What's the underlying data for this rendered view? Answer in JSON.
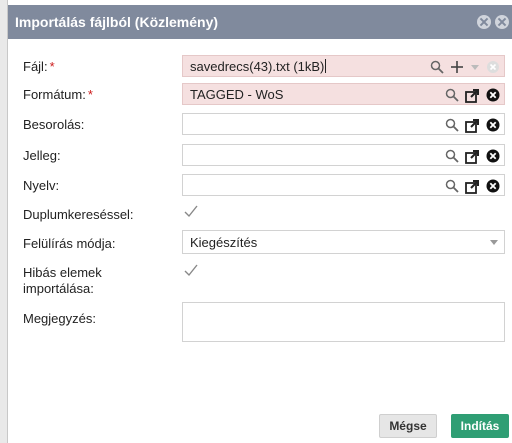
{
  "dialog": {
    "title": "Importálás fájlból (Közlemény)"
  },
  "fields": {
    "file": {
      "label": "Fájl:",
      "required": "*",
      "value": "savedrecs(43).txt (1kB)"
    },
    "format": {
      "label": "Formátum:",
      "required": "*",
      "value": "TAGGED - WoS"
    },
    "classification": {
      "label": "Besorolás:",
      "value": ""
    },
    "type": {
      "label": "Jelleg:",
      "value": ""
    },
    "language": {
      "label": "Nyelv:",
      "value": ""
    },
    "duplicate_search": {
      "label": "Duplumkereséssel:",
      "checked": true
    },
    "overwrite_mode": {
      "label": "Felülírás módja:",
      "value": "Kiegészítés"
    },
    "import_errors": {
      "label_line1": "Hibás elemek",
      "label_line2": "importálása:",
      "checked": true
    },
    "note": {
      "label": "Megjegyzés:",
      "value": ""
    }
  },
  "buttons": {
    "cancel": "Mégse",
    "start": "Indítás"
  },
  "colors": {
    "titlebar": "#808a9d",
    "error_field": "#f5e0e0",
    "primary": "#2f9e74"
  }
}
